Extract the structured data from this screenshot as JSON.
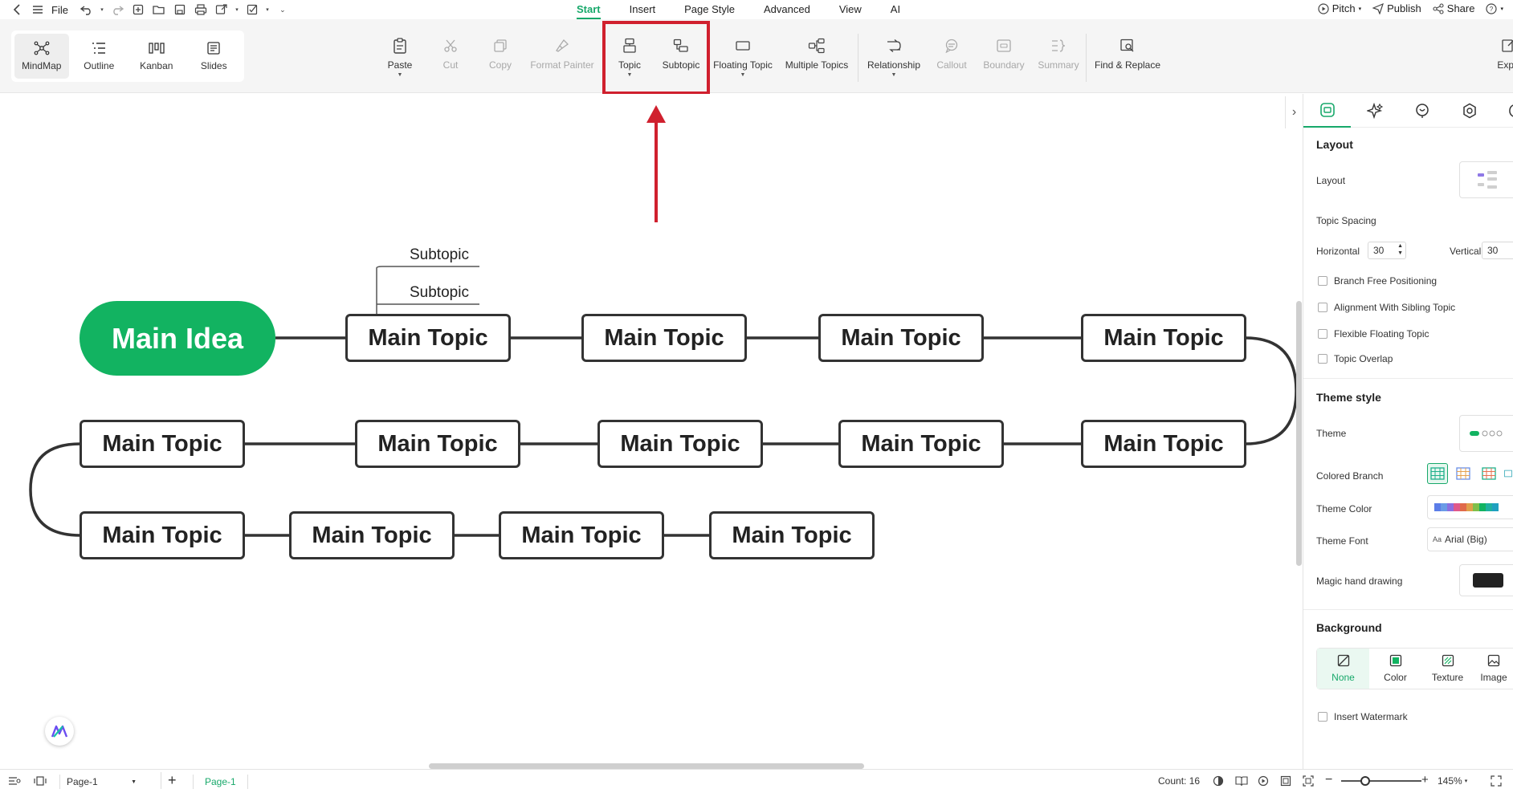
{
  "menu": {
    "file": "File",
    "tabs": [
      "Start",
      "Insert",
      "Page Style",
      "Advanced",
      "View",
      "AI"
    ],
    "active_tab": "Start",
    "right": {
      "pitch": "Pitch",
      "publish": "Publish",
      "share": "Share",
      "help": "?"
    }
  },
  "views": [
    {
      "label": "MindMap",
      "icon": "mindmap-icon",
      "active": true
    },
    {
      "label": "Outline",
      "icon": "outline-icon"
    },
    {
      "label": "Kanban",
      "icon": "kanban-icon"
    },
    {
      "label": "Slides",
      "icon": "slides-icon"
    }
  ],
  "ribbon": {
    "paste": "Paste",
    "cut": "Cut",
    "copy": "Copy",
    "format_painter": "Format Painter",
    "topic": "Topic",
    "subtopic": "Subtopic",
    "floating_topic": "Floating Topic",
    "multiple_topics": "Multiple Topics",
    "relationship": "Relationship",
    "callout": "Callout",
    "boundary": "Boundary",
    "summary": "Summary",
    "find_replace": "Find & Replace",
    "export": "Expo"
  },
  "colors": {
    "accent": "#17a86a",
    "main_idea": "#12b361",
    "highlight": "#d0202e"
  },
  "mindmap": {
    "main_idea": "Main Idea",
    "subtopics": [
      "Subtopic",
      "Subtopic"
    ],
    "topics": [
      "Main Topic",
      "Main Topic",
      "Main Topic",
      "Main Topic",
      "Main Topic",
      "Main Topic",
      "Main Topic",
      "Main Topic",
      "Main Topic",
      "Main Topic",
      "Main Topic",
      "Main Topic",
      "Main Topic"
    ]
  },
  "panel": {
    "layout_section": "Layout",
    "layout": "Layout",
    "topic_spacing": "Topic Spacing",
    "horizontal": "Horizontal",
    "horizontal_value": "30",
    "vertical": "Vertical",
    "vertical_value": "30",
    "checks": [
      "Branch Free Positioning",
      "Alignment With Sibling Topic",
      "Flexible Floating Topic",
      "Topic Overlap"
    ],
    "theme_section": "Theme style",
    "theme": "Theme",
    "colored_branch": "Colored Branch",
    "theme_color": "Theme Color",
    "theme_font": "Theme Font",
    "theme_font_value": "Arial (Big)",
    "magic_hand": "Magic hand drawing",
    "background_section": "Background",
    "bg_options": [
      "None",
      "Color",
      "Texture",
      "Image"
    ],
    "insert_watermark": "Insert Watermark"
  },
  "status": {
    "page_select": "Page-1",
    "page_tab": "Page-1",
    "count": "Count: 16",
    "zoom": "145%"
  }
}
